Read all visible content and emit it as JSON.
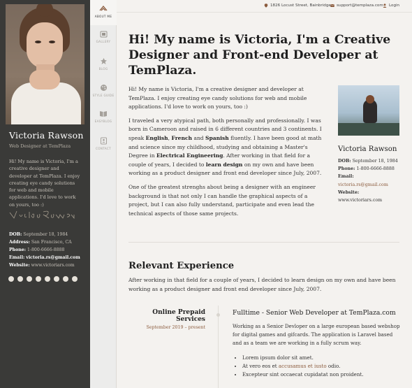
{
  "sidebar": {
    "name": "Victoria Rawson",
    "role": "Web Designer at TemPlaza",
    "bio": "Hi! My name is Victoria, I'm a creative designer and developer at TemPlaza. I enjoy creating eye candy solutions for web and mobile applications. I'd love to work on yours, too :)",
    "signature": "Victoria Rawson",
    "details": {
      "dob_label": "DOB:",
      "dob": "September 18, 1984",
      "address_label": "Address:",
      "address": "San Francisco, CA",
      "phone_label": "Phone:",
      "phone": "1-800-6666-8888",
      "email_label": "Email:",
      "email": "victoria.rs@gmail.com",
      "website_label": "Website:",
      "website": "www.victoriars.com"
    },
    "socials": [
      "facebook-icon",
      "twitter-icon",
      "instagram-icon",
      "linkedin-icon",
      "tumblr-icon",
      "dribbble-icon",
      "youtube-icon",
      "vimeo-icon"
    ]
  },
  "nav": {
    "items": [
      {
        "label": "ABOUT ME",
        "icon": "about-icon",
        "active": true
      },
      {
        "label": "GALLERY",
        "icon": "gallery-icon",
        "active": false
      },
      {
        "label": "BLOG",
        "icon": "blog-icon",
        "active": false
      },
      {
        "label": "STYLE GUIDE",
        "icon": "palette-icon",
        "active": false
      },
      {
        "label": "EASYBLOG",
        "icon": "book-icon",
        "active": false
      },
      {
        "label": "CONTACT",
        "icon": "contact-icon",
        "active": false
      }
    ]
  },
  "topbar": {
    "address": "1826 Locust Street, Bainbridge",
    "email": "support@templaza.com",
    "login": "Login"
  },
  "main": {
    "headline": "Hi! My name is Victoria, I'm a Creative Designer and Front-end Developer at TemPlaza.",
    "p1": "Hi! My name is Victoria, I'm a creative designer and developer at TemPlaza. I enjoy creating eye candy solutions for web and mobile applications. I'd love to work on yours, too :)",
    "p2_a": "I traveled a very atypical path, both personally and professionally. I was born in Cameroon and raised in 6 different countries and 3 continents. I speak ",
    "p2_english": "English",
    "p2_comma": ", ",
    "p2_french": "French",
    "p2_and": " and ",
    "p2_spanish": "Spanish",
    "p2_b": " fluently. I have been good at math and science since my childhood, studying and obtaining a Master's Degree in ",
    "p2_ee": "Electrical Engineering",
    "p2_c": ". After working in that field for a couple of years, I decided to ",
    "p2_learn": "learn design",
    "p2_d": " on my own and have been working as a product designer and front end developer since July, 2007.",
    "p3": "One of the greatest strenghs about being a designer with an engineer background is that not only I can handle the graphical aspects of a project, but I can also fully understand, participate and even lead the technical aspects of those same projects."
  },
  "card": {
    "name": "Victoria Rawson",
    "dob_label": "DOB:",
    "dob": "September 18, 1984",
    "phone_label": "Phone:",
    "phone": "1-800-6666-8888",
    "email_label": "Email:",
    "email": "victoria.rs@gmail.com",
    "website_label": "Website:",
    "website": "www.victoriars.com"
  },
  "experience": {
    "title": "Relevant Experience",
    "intro": "After working in that field for a couple of years, I decided to learn design on my own and have been working as a product designer and front end developer since July, 2007.",
    "items": [
      {
        "company": "Online Prepaid Services",
        "dates": "September 2019 – present",
        "title": "Fulltime - Senior Web Developer at TemPlaza.com",
        "desc": "Working as a Senior Devloper on a large european based webshop for digital games and gifcards. The application is Laravel based and as a team we are working in a fully scrum way.",
        "bullets_0": "Lorem ipsum dolor sit amet.",
        "bullets_1_a": "At vero eos et ",
        "bullets_1_link": "accusamus et iusto",
        "bullets_1_b": " odio.",
        "bullets_2": "Excepteur sint occaecat cupidatat non proident."
      }
    ]
  },
  "colors": {
    "sidebar_bg": "#3a3a38",
    "accent": "#8a5a3c",
    "page_bg": "#f4f2ef"
  }
}
